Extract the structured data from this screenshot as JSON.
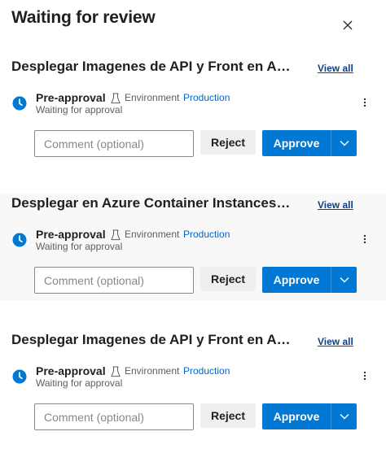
{
  "panel": {
    "title": "Waiting for review",
    "close_icon": "close-icon"
  },
  "stages": [
    {
      "name": "Desplegar Imagenes de API y Front en A…",
      "view_all": "View all",
      "check": {
        "name": "Pre-approval",
        "env_label": "Environment",
        "env_name": "Production",
        "status": "Waiting for approval"
      },
      "comment_placeholder": "Comment (optional)",
      "reject_label": "Reject",
      "approve_label": "Approve"
    },
    {
      "name": "Desplegar en Azure Container Instances …",
      "view_all": "View all",
      "check": {
        "name": "Pre-approval",
        "env_label": "Environment",
        "env_name": "Production",
        "status": "Waiting for approval"
      },
      "comment_placeholder": "Comment (optional)",
      "reject_label": "Reject",
      "approve_label": "Approve"
    },
    {
      "name": "Desplegar Imagenes de API y Front en A…",
      "view_all": "View all",
      "check": {
        "name": "Pre-approval",
        "env_label": "Environment",
        "env_name": "Production",
        "status": "Waiting for approval"
      },
      "comment_placeholder": "Comment (optional)",
      "reject_label": "Reject",
      "approve_label": "Approve"
    }
  ],
  "colors": {
    "accent": "#0078d4",
    "link": "#0066cc",
    "view_all": "#0f3f8c"
  }
}
